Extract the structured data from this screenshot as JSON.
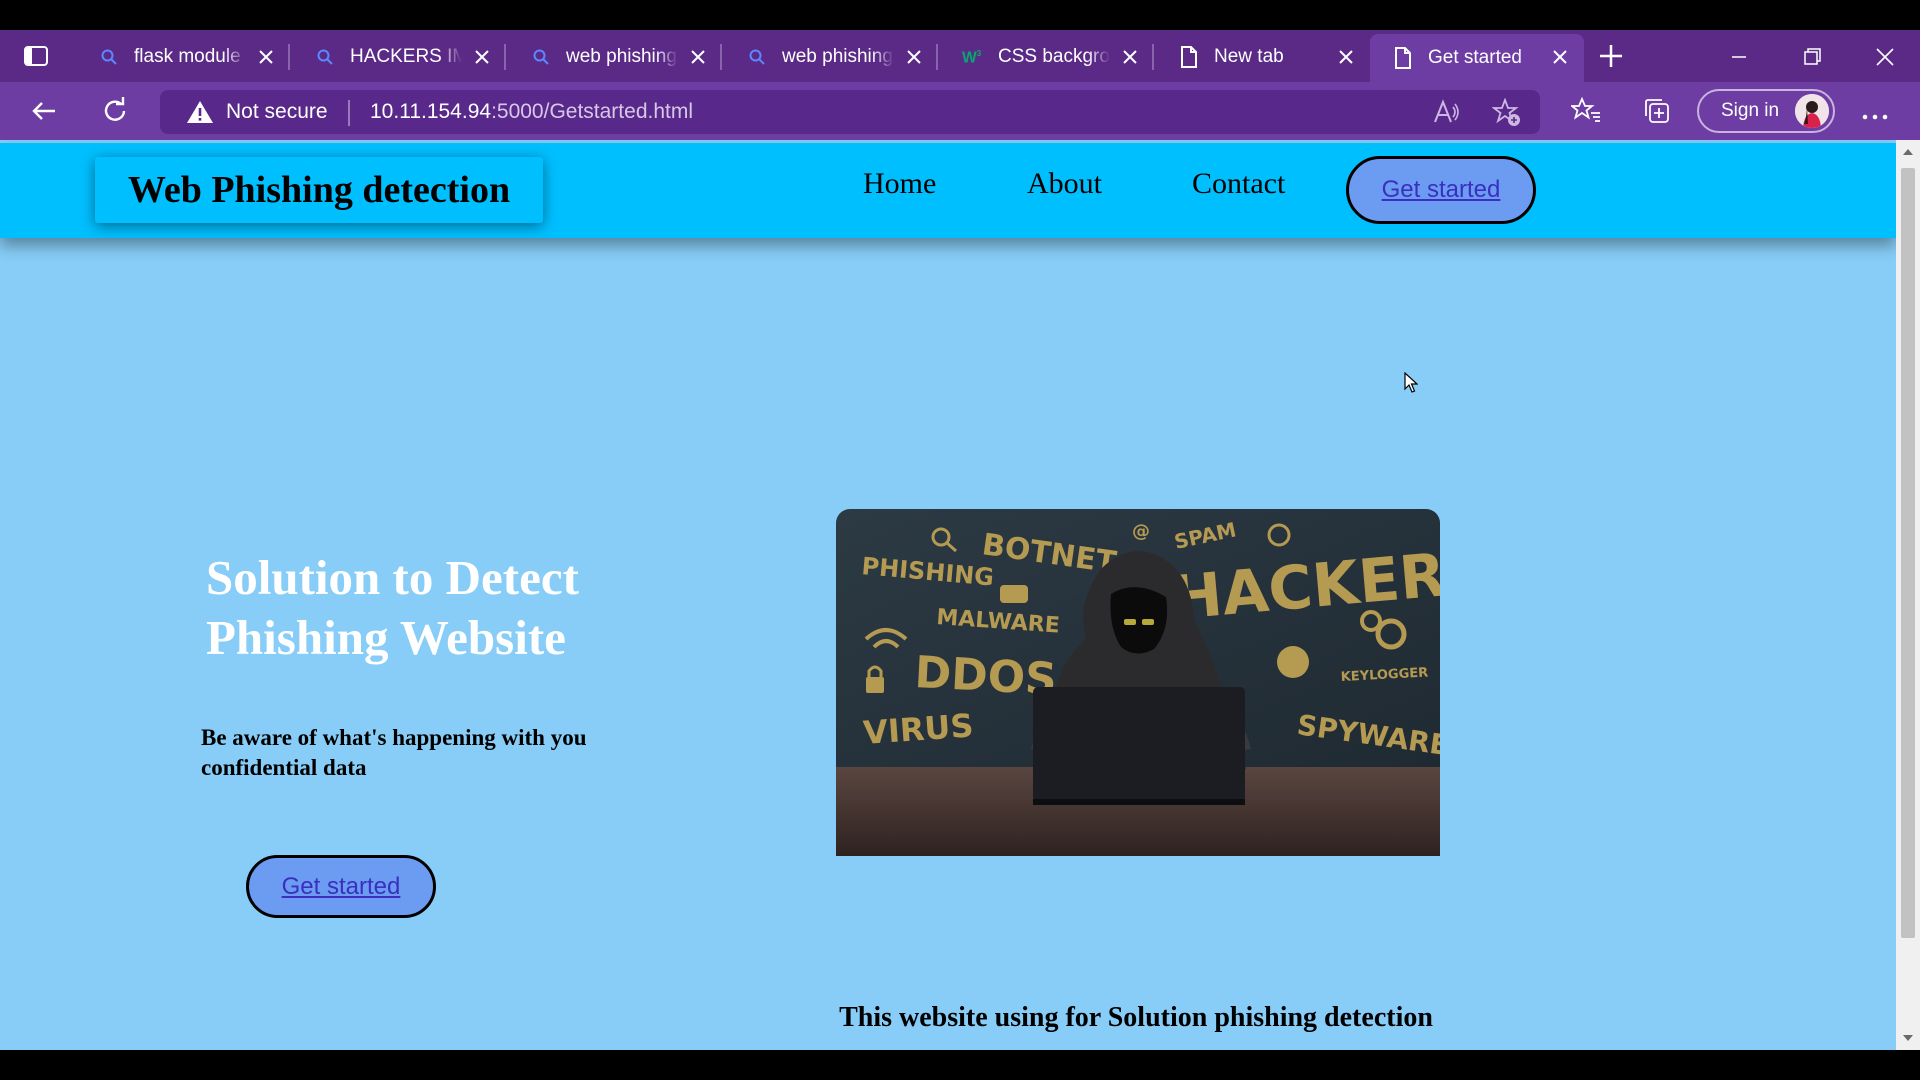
{
  "browser": {
    "tabs": [
      {
        "title": "flask module",
        "favicon": "search-icon"
      },
      {
        "title": "HACKERS IMAGES",
        "favicon": "search-icon"
      },
      {
        "title": "web phishing",
        "favicon": "search-icon"
      },
      {
        "title": "web phishing",
        "favicon": "search-icon"
      },
      {
        "title": "CSS background",
        "favicon": "w3schools-icon"
      },
      {
        "title": "New tab",
        "favicon": "page-icon"
      },
      {
        "title": "Get started",
        "favicon": "page-icon",
        "active": true
      }
    ],
    "security_label": "Not secure",
    "url_host": "10.11.154.94",
    "url_rest": ":5000/Getstarted.html",
    "signin_label": "Sign in",
    "colors": {
      "frame": "#5b2a86",
      "toolbar": "#6e3da3",
      "omnibox": "#58298a"
    }
  },
  "site": {
    "brand": "Web Phishing detection",
    "nav": {
      "home": "Home",
      "about": "About",
      "contact": "Contact"
    },
    "header_button": "Get started",
    "hero": {
      "title_line1": "Solution to Detect",
      "title_line2": "Phishing Website",
      "subtitle_line1": "Be aware of what's happening with you",
      "subtitle_line2": "confidential data",
      "button": "Get started"
    },
    "image_words": {
      "botnet": "BOTNET",
      "spam": "SPAM",
      "phishing": "PHISHING",
      "hacker": "HACKER",
      "malware": "MALWARE",
      "ddos": "DDOS",
      "virus": "VIRUS",
      "keylogger": "KEYLOGGER",
      "spyware": "SPYWARE"
    },
    "footer": "This website using for Solution phishing detection",
    "colors": {
      "background": "#87cdf7",
      "header": "#00bfff",
      "button": "#6b9cf1",
      "link": "#3a2fbf"
    }
  }
}
